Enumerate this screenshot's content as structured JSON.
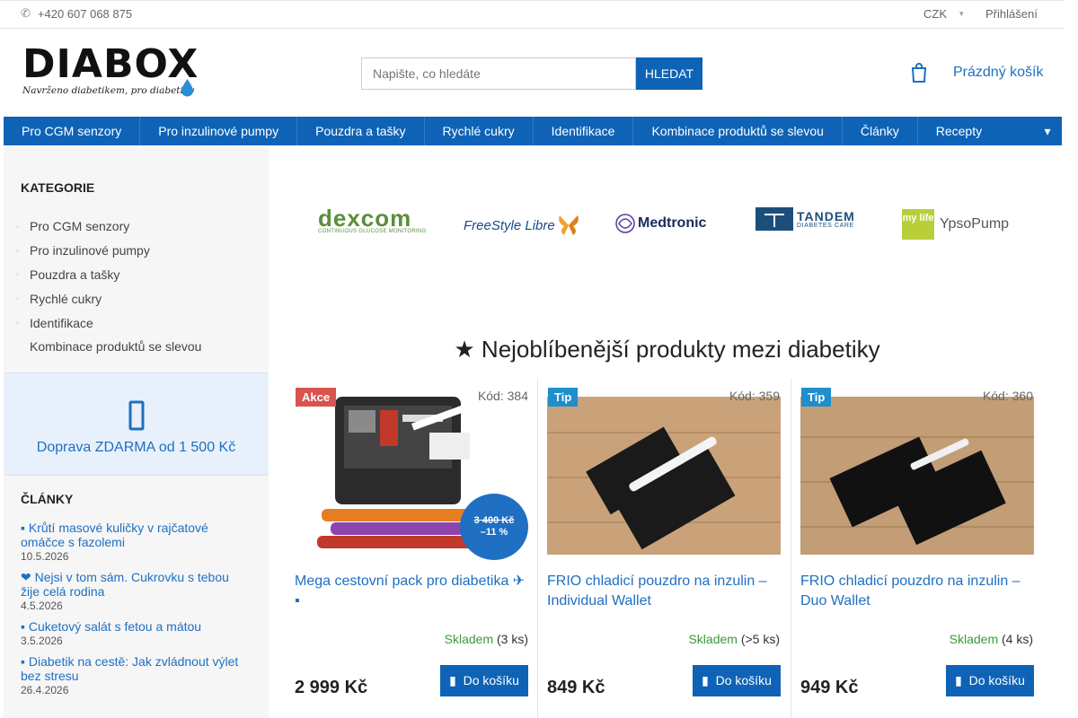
{
  "topbar": {
    "phone_icon": "phone-icon",
    "phone": "+420 607 068 875",
    "currency": "CZK",
    "currency_icon": "chevron-down-icon",
    "login": "Přihlášení"
  },
  "header": {
    "logo_title": "DIABOX",
    "logo_subtitle": "Navrženo diabetikem, pro diabetiky",
    "search_placeholder": "Napište, co hledáte",
    "search_button": "HLEDAT",
    "cart_icon": "cart-icon",
    "cart_label": "Prázdný košík"
  },
  "nav": {
    "items": [
      {
        "label": "Pro CGM senzory"
      },
      {
        "label": "Pro inzulinové pumpy"
      },
      {
        "label": "Pouzdra a tašky"
      },
      {
        "label": "Rychlé cukry"
      },
      {
        "label": "Identifikace"
      },
      {
        "label": "Kombinace produktů se slevou"
      },
      {
        "label": "Články"
      },
      {
        "label": "Recepty"
      }
    ],
    "more_icon": "chevron-down-icon"
  },
  "sidebar": {
    "categories_heading": "KATEGORIE",
    "categories": [
      {
        "label": "Pro CGM senzory"
      },
      {
        "label": "Pro inzulinové pumpy"
      },
      {
        "label": "Pouzdra a tašky"
      },
      {
        "label": "Rychlé cukry"
      },
      {
        "label": "Identifikace"
      },
      {
        "label": "Kombinace produktů se slevou"
      }
    ],
    "shipping_icon": "truck-icon",
    "shipping_text": "Doprava ZDARMA od 1 500 Kč",
    "articles_heading": "ČLÁNKY",
    "articles": [
      {
        "title": "Krůtí masové kuličky v rajčatové omáčce s fazolemi",
        "date": "10.5.2026",
        "icon": "utensils-icon"
      },
      {
        "title": "❤ Nejsi v tom sám. Cukrovku s tebou žije celá rodina",
        "date": "4.5.2026",
        "icon": ""
      },
      {
        "title": "Cuketový salát s fetou a mátou",
        "date": "3.5.2026",
        "icon": "utensils-icon"
      },
      {
        "title": "Diabetik na cestě: Jak zvládnout výlet bez stresu",
        "date": "26.4.2026",
        "icon": "airplane-icon"
      }
    ]
  },
  "brands": [
    {
      "name": "dexcom",
      "tagline": "CONTINUOUS GLUCOSE MONITORING"
    },
    {
      "name": "FreeStyle Libre"
    },
    {
      "name": "Medtronic"
    },
    {
      "name": "TANDEM",
      "tagline": "DIABETES CARE"
    },
    {
      "name": "YpsoPump",
      "prefix": "my life"
    }
  ],
  "products_section": {
    "title": "Nejoblíbenější produkty mezi diabetiky",
    "title_icon": "star-icon"
  },
  "products": [
    {
      "badge": "Akce",
      "code": "Kód: 384",
      "name": "Mega cestovní pack pro diabetika ✈",
      "name_icon": "suitcase-icon",
      "old_price": "3 400 Kč",
      "discount": "–11 %",
      "stock_status": "Skladem",
      "stock_count": "(3 ks)",
      "price": "2 999 Kč",
      "button": "Do košíku",
      "button_icon": "cart-icon"
    },
    {
      "badge": "Tip",
      "code": "Kód: 359",
      "name": "FRIO chladicí pouzdro na inzulin – Individual Wallet",
      "stock_status": "Skladem",
      "stock_count": "(>5 ks)",
      "price": "849 Kč",
      "button": "Do košíku",
      "button_icon": "cart-icon"
    },
    {
      "badge": "Tip",
      "code": "Kód: 360",
      "name": "FRIO chladicí pouzdro na inzulin – Duo Wallet",
      "stock_status": "Skladem",
      "stock_count": "(4 ks)",
      "price": "949 Kč",
      "button": "Do košíku",
      "button_icon": "cart-icon"
    }
  ],
  "colors": {
    "primary": "#0f63b6",
    "link": "#1f6fc2",
    "stock_green": "#3a9a3a",
    "badge_akce": "#d9534f",
    "badge_tip": "#1f8ecb"
  }
}
